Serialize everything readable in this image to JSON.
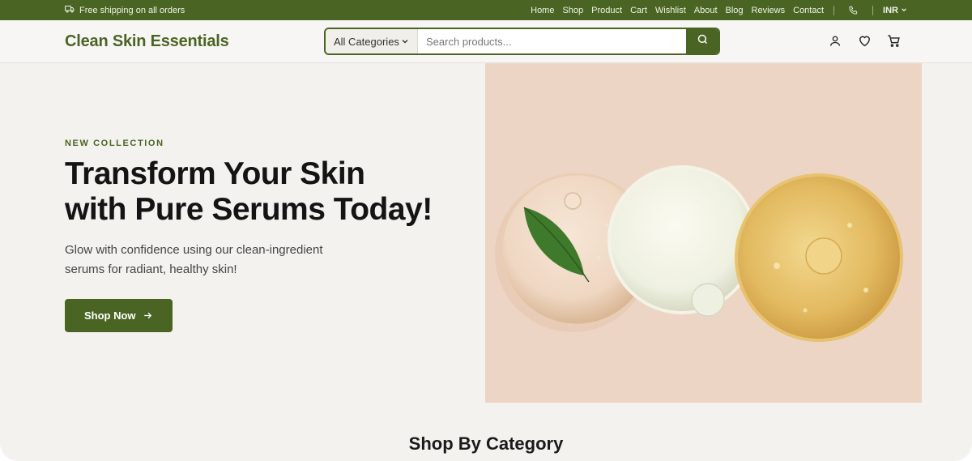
{
  "topbar": {
    "shipping_text": "Free shipping on all orders",
    "nav": [
      "Home",
      "Shop",
      "Product",
      "Cart",
      "Wishlist",
      "About",
      "Blog",
      "Reviews",
      "Contact"
    ],
    "currency": "INR"
  },
  "header": {
    "logo": "Clean Skin Essentials",
    "search": {
      "category": "All Categories",
      "placeholder": "Search products..."
    }
  },
  "hero": {
    "eyebrow": "NEW COLLECTION",
    "headline_line1": "Transform Your Skin",
    "headline_line2": "with Pure Serums Today!",
    "subtext": "Glow with confidence using our clean-ingredient serums for radiant, healthy skin!",
    "cta": "Shop Now"
  },
  "sections": {
    "category_title": "Shop By Category"
  },
  "colors": {
    "brand": "#4a6523",
    "background": "#f4f2ef",
    "hero_image_bg": "#edd5c5"
  }
}
